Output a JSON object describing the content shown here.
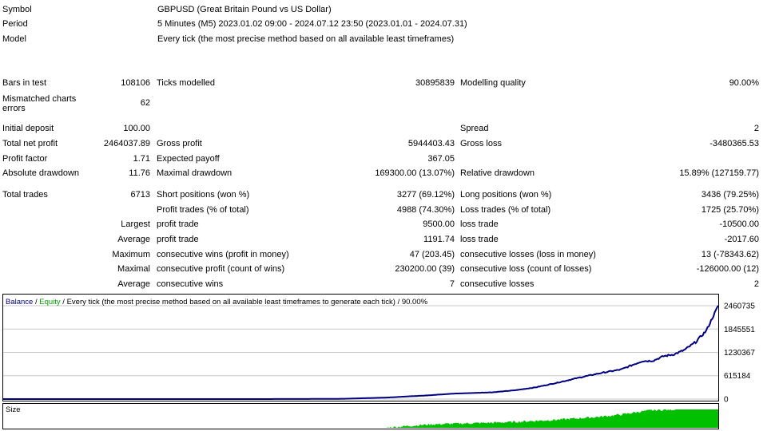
{
  "header": {
    "symbol_label": "Symbol",
    "symbol_value": "GBPUSD (Great Britain Pound vs US Dollar)",
    "period_label": "Period",
    "period_value": "5 Minutes (M5) 2023.01.02 09:00 - 2024.07.12 23:50 (2023.01.01 - 2024.07.31)",
    "model_label": "Model",
    "model_value": "Every tick (the most precise method based on all available least timeframes)"
  },
  "stats": {
    "bars_label": "Bars in test",
    "bars_value": "108106",
    "ticks_label": "Ticks modelled",
    "ticks_value": "30895839",
    "quality_label": "Modelling quality",
    "quality_value": "90.00%",
    "mismatch_label_1": "Mismatched charts",
    "mismatch_label_2": "errors",
    "mismatch_value": "62",
    "deposit_label": "Initial deposit",
    "deposit_value": "100.00",
    "spread_label": "Spread",
    "spread_value": "2",
    "net_label": "Total net profit",
    "net_value": "2464037.89",
    "gross_profit_label": "Gross profit",
    "gross_profit_value": "5944403.43",
    "gross_loss_label": "Gross loss",
    "gross_loss_value": "-3480365.53",
    "pf_label": "Profit factor",
    "pf_value": "1.71",
    "ep_label": "Expected payoff",
    "ep_value": "367.05",
    "abs_dd_label": "Absolute drawdown",
    "abs_dd_value": "11.76",
    "max_dd_label": "Maximal drawdown",
    "max_dd_value": "169300.00 (13.07%)",
    "rel_dd_label": "Relative drawdown",
    "rel_dd_value": "15.89% (127159.77)",
    "trades_label": "Total trades",
    "trades_value": "6713",
    "short_label": "Short positions (won %)",
    "short_value": "3277 (69.12%)",
    "long_label": "Long positions (won %)",
    "long_value": "3436 (79.25%)",
    "ptrades_label": "Profit trades (% of total)",
    "ptrades_value": "4988 (74.30%)",
    "ltrades_label": "Loss trades (% of total)",
    "ltrades_value": "1725 (25.70%)",
    "largest_label": "Largest",
    "largest_pt_label": "profit trade",
    "largest_pt_value": "9500.00",
    "largest_lt_label": "loss trade",
    "largest_lt_value": "-10500.00",
    "average_label": "Average",
    "average_pt_label": "profit trade",
    "average_pt_value": "1191.74",
    "average_lt_label": "loss trade",
    "average_lt_value": "-2017.60",
    "maximum_label": "Maximum",
    "max_cw_label": "consecutive wins (profit in money)",
    "max_cw_value": "47 (203.45)",
    "max_cl_label": "consecutive losses (loss in money)",
    "max_cl_value": "13 (-78343.62)",
    "maximal_label": "Maximal",
    "mxl_cp_label": "consecutive profit (count of wins)",
    "mxl_cp_value": "230200.00 (39)",
    "mxl_cl_label": "consecutive loss (count of losses)",
    "mxl_cl_value": "-126000.00 (12)",
    "average2_label": "Average",
    "avg_cw_label": "consecutive wins",
    "avg_cw_value": "7",
    "avg_cl_label": "consecutive losses",
    "avg_cl_value": "2"
  },
  "chart_data": {
    "type": "line",
    "legend_balance": "Balance",
    "legend_sep1": " / ",
    "legend_equity": "Equity",
    "legend_rest": " / Every tick (the most precise method based on all available least timeframes to generate each tick) / 90.00%",
    "balance_color": "#000080",
    "equity_color": "#00a000",
    "size_color": "#00c000",
    "yticks": [
      0,
      615184,
      1230367,
      1845551,
      2460735
    ],
    "yticks_labels": [
      "0",
      "615184",
      "1230367",
      "1845551",
      "2460735"
    ],
    "ylim": [
      0,
      2460735
    ],
    "x": [
      0,
      400,
      800,
      1200,
      1600,
      2000,
      2400,
      2800,
      3200,
      3600,
      3800,
      4000,
      4200,
      4400,
      4600,
      4800,
      5000,
      5200,
      5400,
      5600,
      5800,
      6000,
      6100,
      6200,
      6300,
      6400,
      6500,
      6600,
      6713
    ],
    "balance": [
      100,
      100,
      150,
      200,
      300,
      400,
      600,
      2000,
      8000,
      40000,
      70000,
      100000,
      140000,
      160000,
      180000,
      230000,
      310000,
      430000,
      560000,
      680000,
      780000,
      1000000,
      1010000,
      1130000,
      1180000,
      1300000,
      1500000,
      1800000,
      2460735
    ],
    "xlim": [
      0,
      6713
    ],
    "size_label": "Size",
    "size_values": [
      0,
      0,
      0,
      0,
      0,
      0,
      0,
      0,
      0,
      0,
      0.1,
      0.18,
      0.22,
      0.25,
      0.28,
      0.32,
      0.38,
      0.44,
      0.52,
      0.6,
      0.72,
      0.9,
      0.96,
      0.98,
      1.0,
      1.0,
      1.0,
      1.0,
      1.0
    ]
  }
}
